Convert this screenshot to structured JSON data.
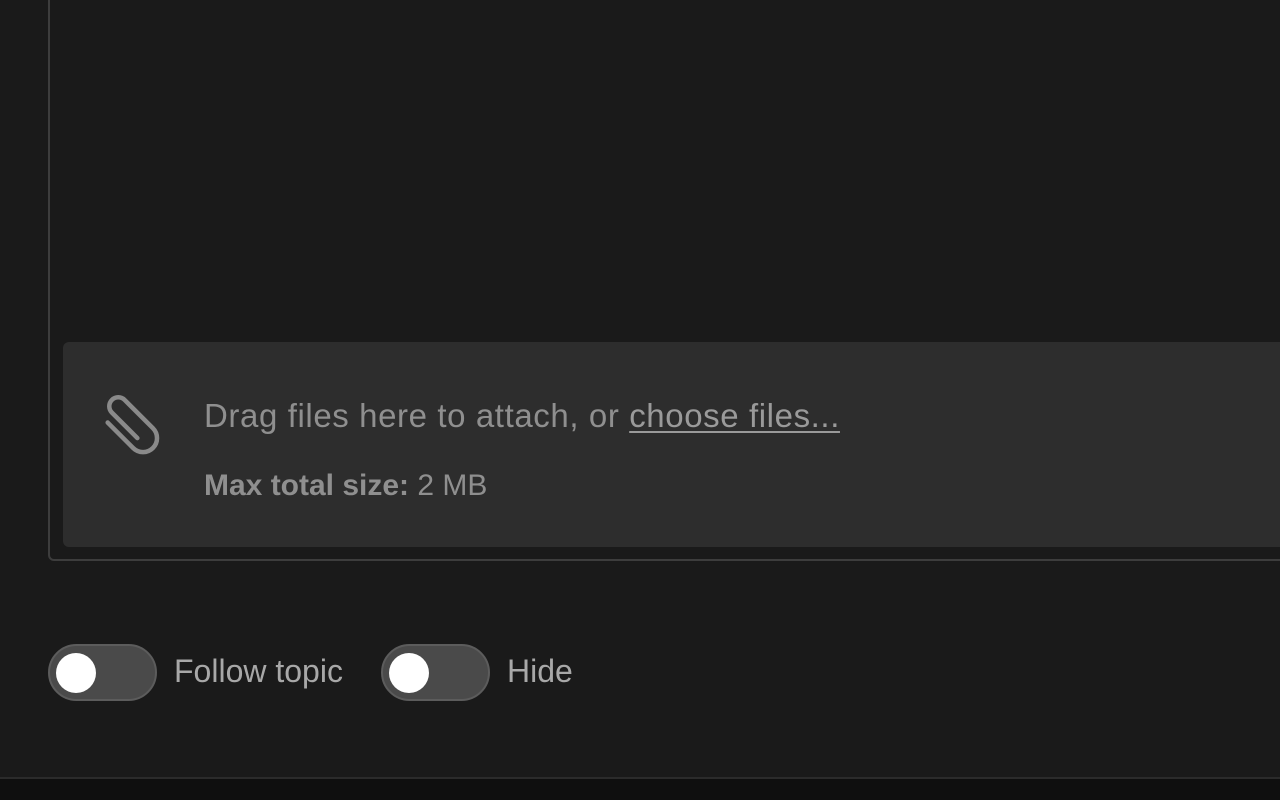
{
  "attachment": {
    "drag_text": "Drag files here to attach, or ",
    "choose_link": "choose files...",
    "max_size_label": "Max total size:",
    "max_size_value": " 2 MB",
    "icon": "paperclip-icon"
  },
  "toggles": [
    {
      "label": "Follow topic",
      "on": false
    },
    {
      "label": "Hide",
      "on": false
    }
  ],
  "colors": {
    "background": "#1a1a1a",
    "dropzone": "#2d2d2d",
    "text": "#8f8f8f",
    "toggle_track": "#4a4a4a",
    "toggle_knob": "#ffffff"
  }
}
